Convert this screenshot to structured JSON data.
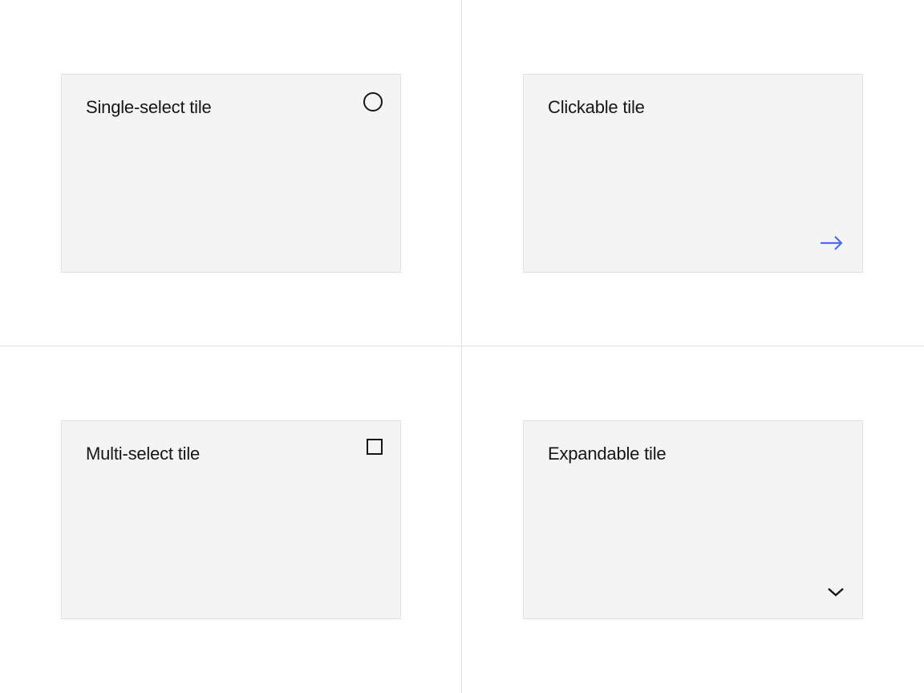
{
  "tiles": {
    "singleSelect": {
      "label": "Single-select tile"
    },
    "clickable": {
      "label": "Clickable tile"
    },
    "multiSelect": {
      "label": "Multi-select tile"
    },
    "expandable": {
      "label": "Expandable tile"
    }
  },
  "colors": {
    "tileBg": "#f4f4f4",
    "tileBorder": "#e0e0e0",
    "text": "#161616",
    "accentBlue": "#4c6ef5"
  }
}
